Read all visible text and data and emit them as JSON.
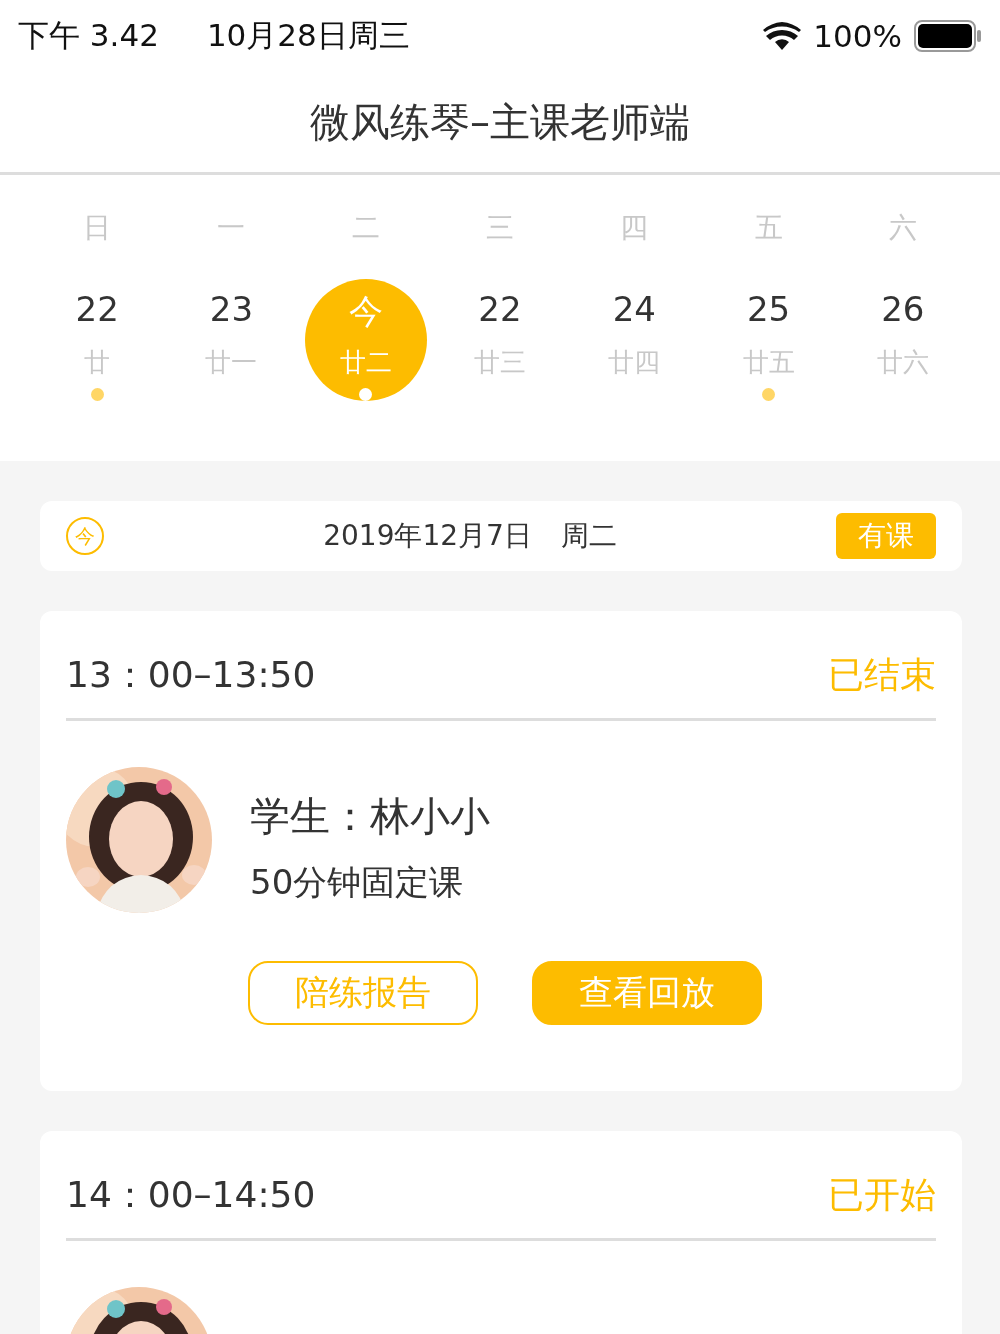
{
  "status_bar": {
    "time": "下午 3.42",
    "date": "10月28日周三",
    "battery": "100%"
  },
  "header": {
    "title": "微风练琴–主课老师端"
  },
  "calendar": {
    "weekdays": [
      "日",
      "一",
      "二",
      "三",
      "四",
      "五",
      "六"
    ],
    "days": [
      {
        "day": "22",
        "lunar": "廿",
        "selected": false,
        "marked": true
      },
      {
        "day": "23",
        "lunar": "廿一",
        "selected": false,
        "marked": false
      },
      {
        "day": "今",
        "lunar": "廿二",
        "selected": true,
        "marked": true
      },
      {
        "day": "22",
        "lunar": "廿三",
        "selected": false,
        "marked": false
      },
      {
        "day": "24",
        "lunar": "廿四",
        "selected": false,
        "marked": false
      },
      {
        "day": "25",
        "lunar": "廿五",
        "selected": false,
        "marked": true
      },
      {
        "day": "26",
        "lunar": "廿六",
        "selected": false,
        "marked": false
      }
    ]
  },
  "date_bar": {
    "badge": "今",
    "date": "2019年12月7日",
    "weekday": "周二",
    "tag": "有课"
  },
  "lessons": [
    {
      "time": "13：00–13:50",
      "status": "已结束",
      "student": "学生：林小小",
      "course": "50分钟固定课",
      "buttons": [
        {
          "label": "陪练报告",
          "kind": "outline"
        },
        {
          "label": "查看回放",
          "kind": "filled"
        }
      ]
    },
    {
      "time": "14：00–14:50",
      "status": "已开始"
    }
  ]
}
